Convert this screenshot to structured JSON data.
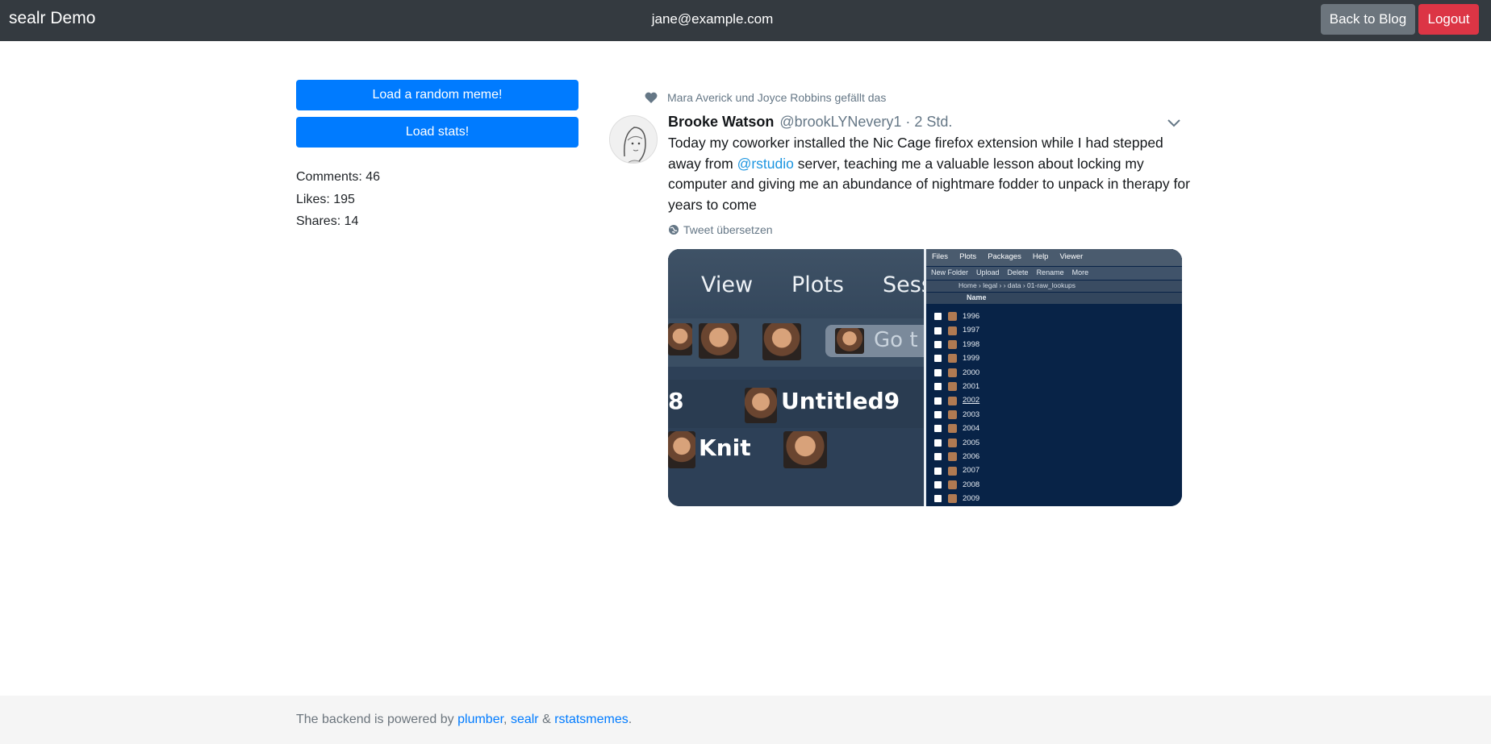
{
  "navbar": {
    "brand": "sealr Demo",
    "user_email": "jane@example.com",
    "back_label": "Back to Blog",
    "logout_label": "Logout"
  },
  "sidebar": {
    "load_meme_label": "Load a random meme!",
    "load_stats_label": "Load stats!",
    "stats": {
      "comments": "Comments: 46",
      "likes": "Likes: 195",
      "shares": "Shares: 14"
    }
  },
  "tweet": {
    "liked_by": "Mara Averick und Joyce Robbins gefällt das",
    "author_name": "Brooke Watson",
    "author_handle": "@brookLYNevery1 · 2 Std.",
    "text_part1": "Today my coworker installed the Nic Cage firefox extension while I had stepped away from ",
    "mention": "@rstudio",
    "text_part2": " server, teaching me a valuable lesson about locking my computer and giving me an abundance of nightmare fodder to unpack in therapy for years to come",
    "translate_label": "Tweet übersetzen",
    "media": {
      "left_tabs": [
        "View",
        "Plots",
        "Sess"
      ],
      "goto_text": "Go t",
      "eight": "8",
      "untitled": "Untitled9",
      "knit": "Knit",
      "right_tabs": [
        "Files",
        "Plots",
        "Packages",
        "Help",
        "Viewer"
      ],
      "toolbar": [
        "New Folder",
        "Upload",
        "Delete",
        "Rename",
        "More"
      ],
      "path": "Home › legal ›              › data › 01-raw_lookups",
      "name_header": "Name",
      "years": [
        "1996",
        "1997",
        "1998",
        "1999",
        "2000",
        "2001",
        "2002",
        "2003",
        "2004",
        "2005",
        "2006",
        "2007",
        "2008",
        "2009"
      ]
    }
  },
  "footer": {
    "prefix": "The backend is powered by ",
    "link1": "plumber",
    "sep1": ", ",
    "link2": "sealr",
    "sep2": " & ",
    "link3": "rstatsmemes",
    "suffix": "."
  }
}
